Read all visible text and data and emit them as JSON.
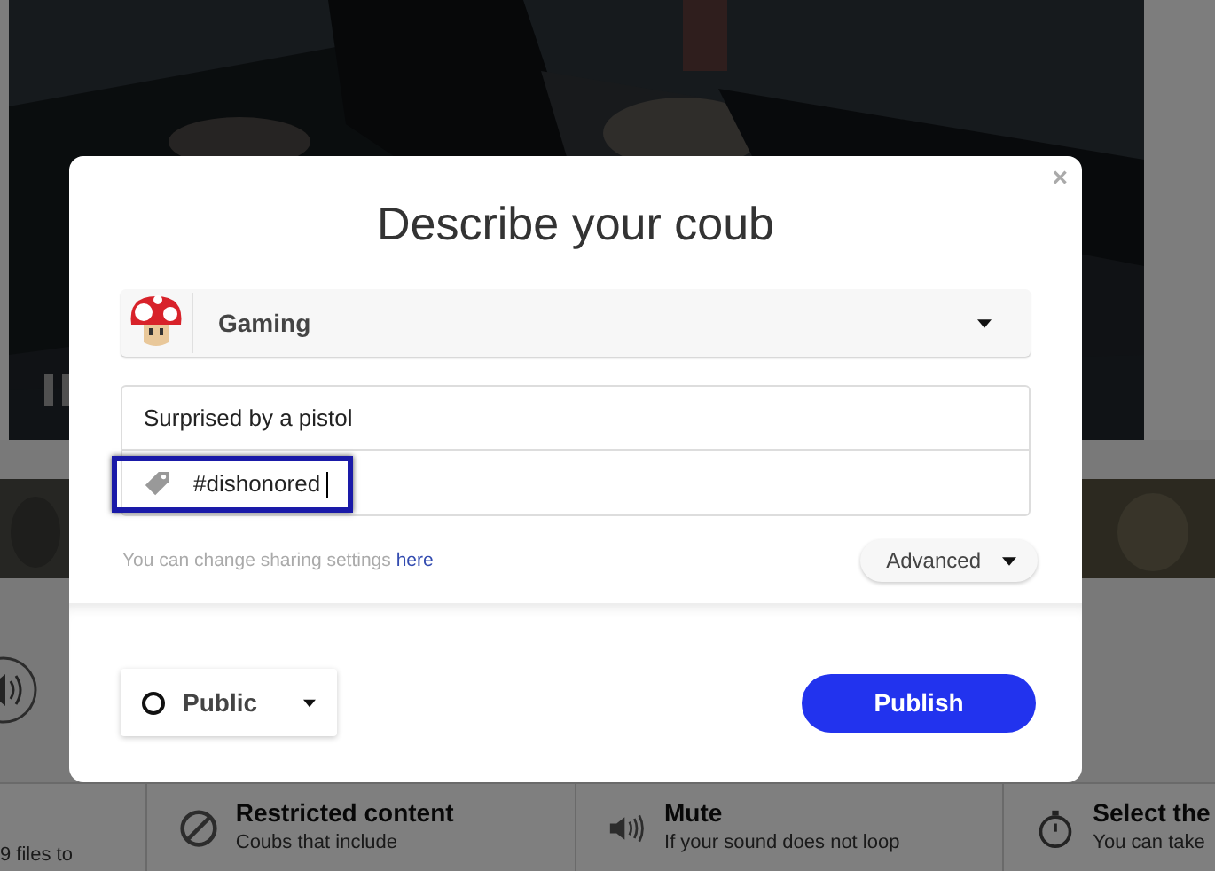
{
  "background": {
    "features": [
      {
        "kind": "plain",
        "description": "9 files to"
      },
      {
        "kind": "ban",
        "title": "Restricted content",
        "description": "Coubs that include"
      },
      {
        "kind": "speaker",
        "title": "Mute",
        "description": "If your sound does not loop"
      },
      {
        "kind": "stopwatch",
        "title": "Select the",
        "description": "You can take"
      }
    ]
  },
  "dialog": {
    "title": "Describe your coub",
    "close": "×",
    "category": {
      "label": "Gaming"
    },
    "title_field": {
      "value": "Surprised by a pistol"
    },
    "tags_field": {
      "value": "#dishonored",
      "focused": true
    },
    "sharing_note": {
      "text": "You can change sharing settings",
      "link": "here"
    },
    "advanced_button": "Advanced",
    "privacy": {
      "label": "Public"
    },
    "publish_button": "Publish"
  }
}
